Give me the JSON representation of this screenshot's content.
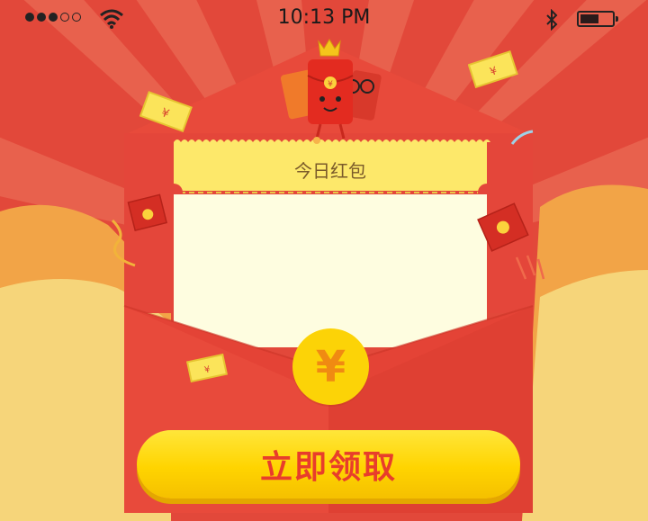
{
  "status_bar": {
    "time": "10:13 PM",
    "signal_bars_filled": 3,
    "signal_bars_total": 5,
    "battery_level": 0.6
  },
  "envelope": {
    "ticket_title": "今日红包",
    "coin_symbol": "¥",
    "claim_button_label": "立即领取"
  },
  "decorations": {
    "note_glyph": "¥",
    "mascot_glyph": "¥"
  },
  "colors": {
    "background": "#e2483a",
    "envelope_red": "#e84a3b",
    "ticket_yellow": "#fde86a",
    "card_cream": "#fefde0",
    "button_yellow": "#ffd400",
    "button_text": "#e83d2b",
    "coin_yellow": "#fcd307"
  }
}
